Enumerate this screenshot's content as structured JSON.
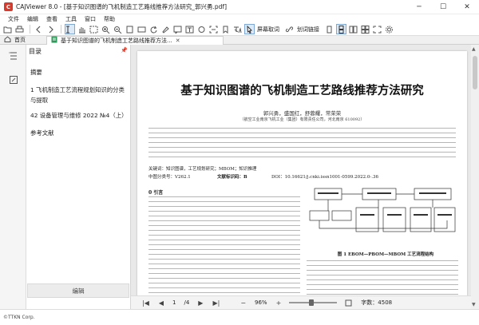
{
  "window": {
    "title": "CAJViewer 8.0 - [基于知识图谱的飞机制造工艺路线推荐方法研究_郭兴勇.pdf]",
    "logo_text": "C",
    "controls": [
      "─",
      "☐",
      "✕"
    ]
  },
  "menu": [
    "文件",
    "编辑",
    "查看",
    "工具",
    "窗口",
    "帮助"
  ],
  "toolbar": {
    "screenshot_label": "屏幕取词",
    "link_label": "划词链接"
  },
  "tabs": {
    "home": "首页",
    "document": "基于知识图谱的飞机制造工艺路线推荐方法..."
  },
  "panel": {
    "title": "目录",
    "toc": [
      "摘要",
      "1 飞机制造工艺流程规划知识的分类与提取",
      "42 设备管理与维修 2022 №4（上）",
      "参考文献"
    ],
    "edit_button": "编辑"
  },
  "document": {
    "title": "基于知识图谱的飞机制造工艺路线推荐方法研究",
    "authors": "郭兴勇，盛国红，舒蓉耀，常荣荣",
    "affiliation": "（航空工业南京飞机工业（集团）有限责任公司，河北南京 610092）",
    "keywords": "关键词：知识图谱，工艺规划研究；MBOM；知识推理",
    "clc": "中图分类号：V262.1",
    "doc_code": "文献标识码：B",
    "doi": "DOI：10.16621/j.cnki.issn1001-0599.2022.0-.36",
    "section_title": "0  引言",
    "figure_caption": "图 1  EBOM—PBOM—MBOM 工艺流程结构"
  },
  "navigation": {
    "page_current": "1",
    "page_total": "/4",
    "zoom": "96%",
    "word_count": "字数：4508",
    "zoom_level": 0.42
  },
  "status": {
    "copyright": "©TTKN Corp."
  },
  "colors": {
    "logo": "#d93a2b",
    "tab_active": "#ffffff",
    "toolbar_active": "#dce9f7",
    "page_background": "#e9e9e9"
  }
}
